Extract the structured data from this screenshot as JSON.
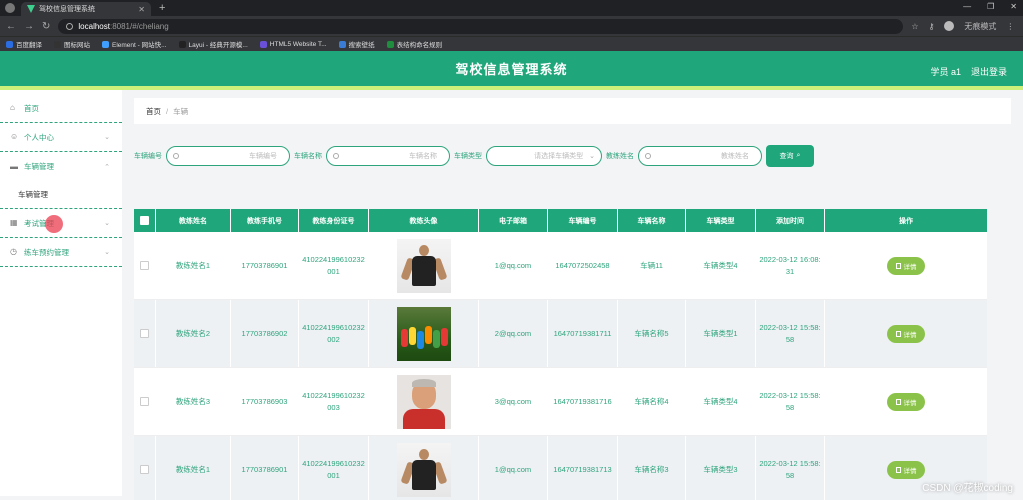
{
  "browser": {
    "tab_title": "驾校信息管理系统",
    "url_host": "localhost",
    "url_path": ":8081/#/cheliang",
    "profile_label": "无痕模式",
    "bookmarks": [
      {
        "label": "百度翻译",
        "color": "#2b6de0"
      },
      {
        "label": "图标网站",
        "color": "#333333"
      },
      {
        "label": "Element - 网站快...",
        "color": "#409eff"
      },
      {
        "label": "Layui - 经典开源模...",
        "color": "#222222"
      },
      {
        "label": "HTML5 Website T...",
        "color": "#6a4fd8"
      },
      {
        "label": "搜索壁纸",
        "color": "#3a7bd5"
      },
      {
        "label": "表结构命名规则",
        "color": "#1e8e3e"
      }
    ]
  },
  "header": {
    "title": "驾校信息管理系统",
    "user": "学员 a1",
    "logout": "退出登录"
  },
  "sidebar": {
    "items": [
      {
        "label": "首页",
        "icon": "home-icon"
      },
      {
        "label": "个人中心",
        "icon": "user-icon"
      },
      {
        "label": "车辆管理",
        "icon": "car-icon"
      },
      {
        "label": "车辆管理",
        "icon": ""
      },
      {
        "label": "考试管理",
        "icon": "grid-icon"
      },
      {
        "label": "练车预约管理",
        "icon": "clock-icon"
      }
    ]
  },
  "breadcrumb": {
    "home": "首页",
    "sep": "/",
    "current": "车辆"
  },
  "search": {
    "fields": [
      {
        "label": "车辆编号",
        "placeholder": "车辆编号"
      },
      {
        "label": "车辆名称",
        "placeholder": "车辆名称"
      },
      {
        "label": "车辆类型",
        "placeholder": "请选择车辆类型"
      },
      {
        "label": "教练姓名",
        "placeholder": "教练姓名"
      }
    ],
    "button": "查询"
  },
  "table": {
    "headers": [
      "教练姓名",
      "教练手机号",
      "教练身份证号",
      "教练头像",
      "电子邮箱",
      "车辆编号",
      "车辆名称",
      "车辆类型",
      "添加时间",
      "操作"
    ],
    "rows": [
      {
        "name": "教练姓名1",
        "phone": "17703786901",
        "id_card": "410224199610232001",
        "email": "1@qq.com",
        "car_no": "1647072502458",
        "car_name": "车辆11",
        "car_type": "车辆类型4",
        "added": "2022-03-12 16:08:31",
        "action": "详情"
      },
      {
        "name": "教练姓名2",
        "phone": "17703786902",
        "id_card": "410224199610232002",
        "email": "2@qq.com",
        "car_no": "16470719381711",
        "car_name": "车辆名称5",
        "car_type": "车辆类型1",
        "added": "2022-03-12 15:58:58",
        "action": "详情"
      },
      {
        "name": "教练姓名3",
        "phone": "17703786903",
        "id_card": "410224199610232003",
        "email": "3@qq.com",
        "car_no": "16470719381716",
        "car_name": "车辆名称4",
        "car_type": "车辆类型4",
        "added": "2022-03-12 15:58:58",
        "action": "详情"
      },
      {
        "name": "教练姓名1",
        "phone": "17703786901",
        "id_card": "410224199610232001",
        "email": "1@qq.com",
        "car_no": "16470719381713",
        "car_name": "车辆名称3",
        "car_type": "车辆类型3",
        "added": "2022-03-12 15:58:58",
        "action": "详情"
      }
    ]
  },
  "watermark": "CSDN @花椒coding"
}
